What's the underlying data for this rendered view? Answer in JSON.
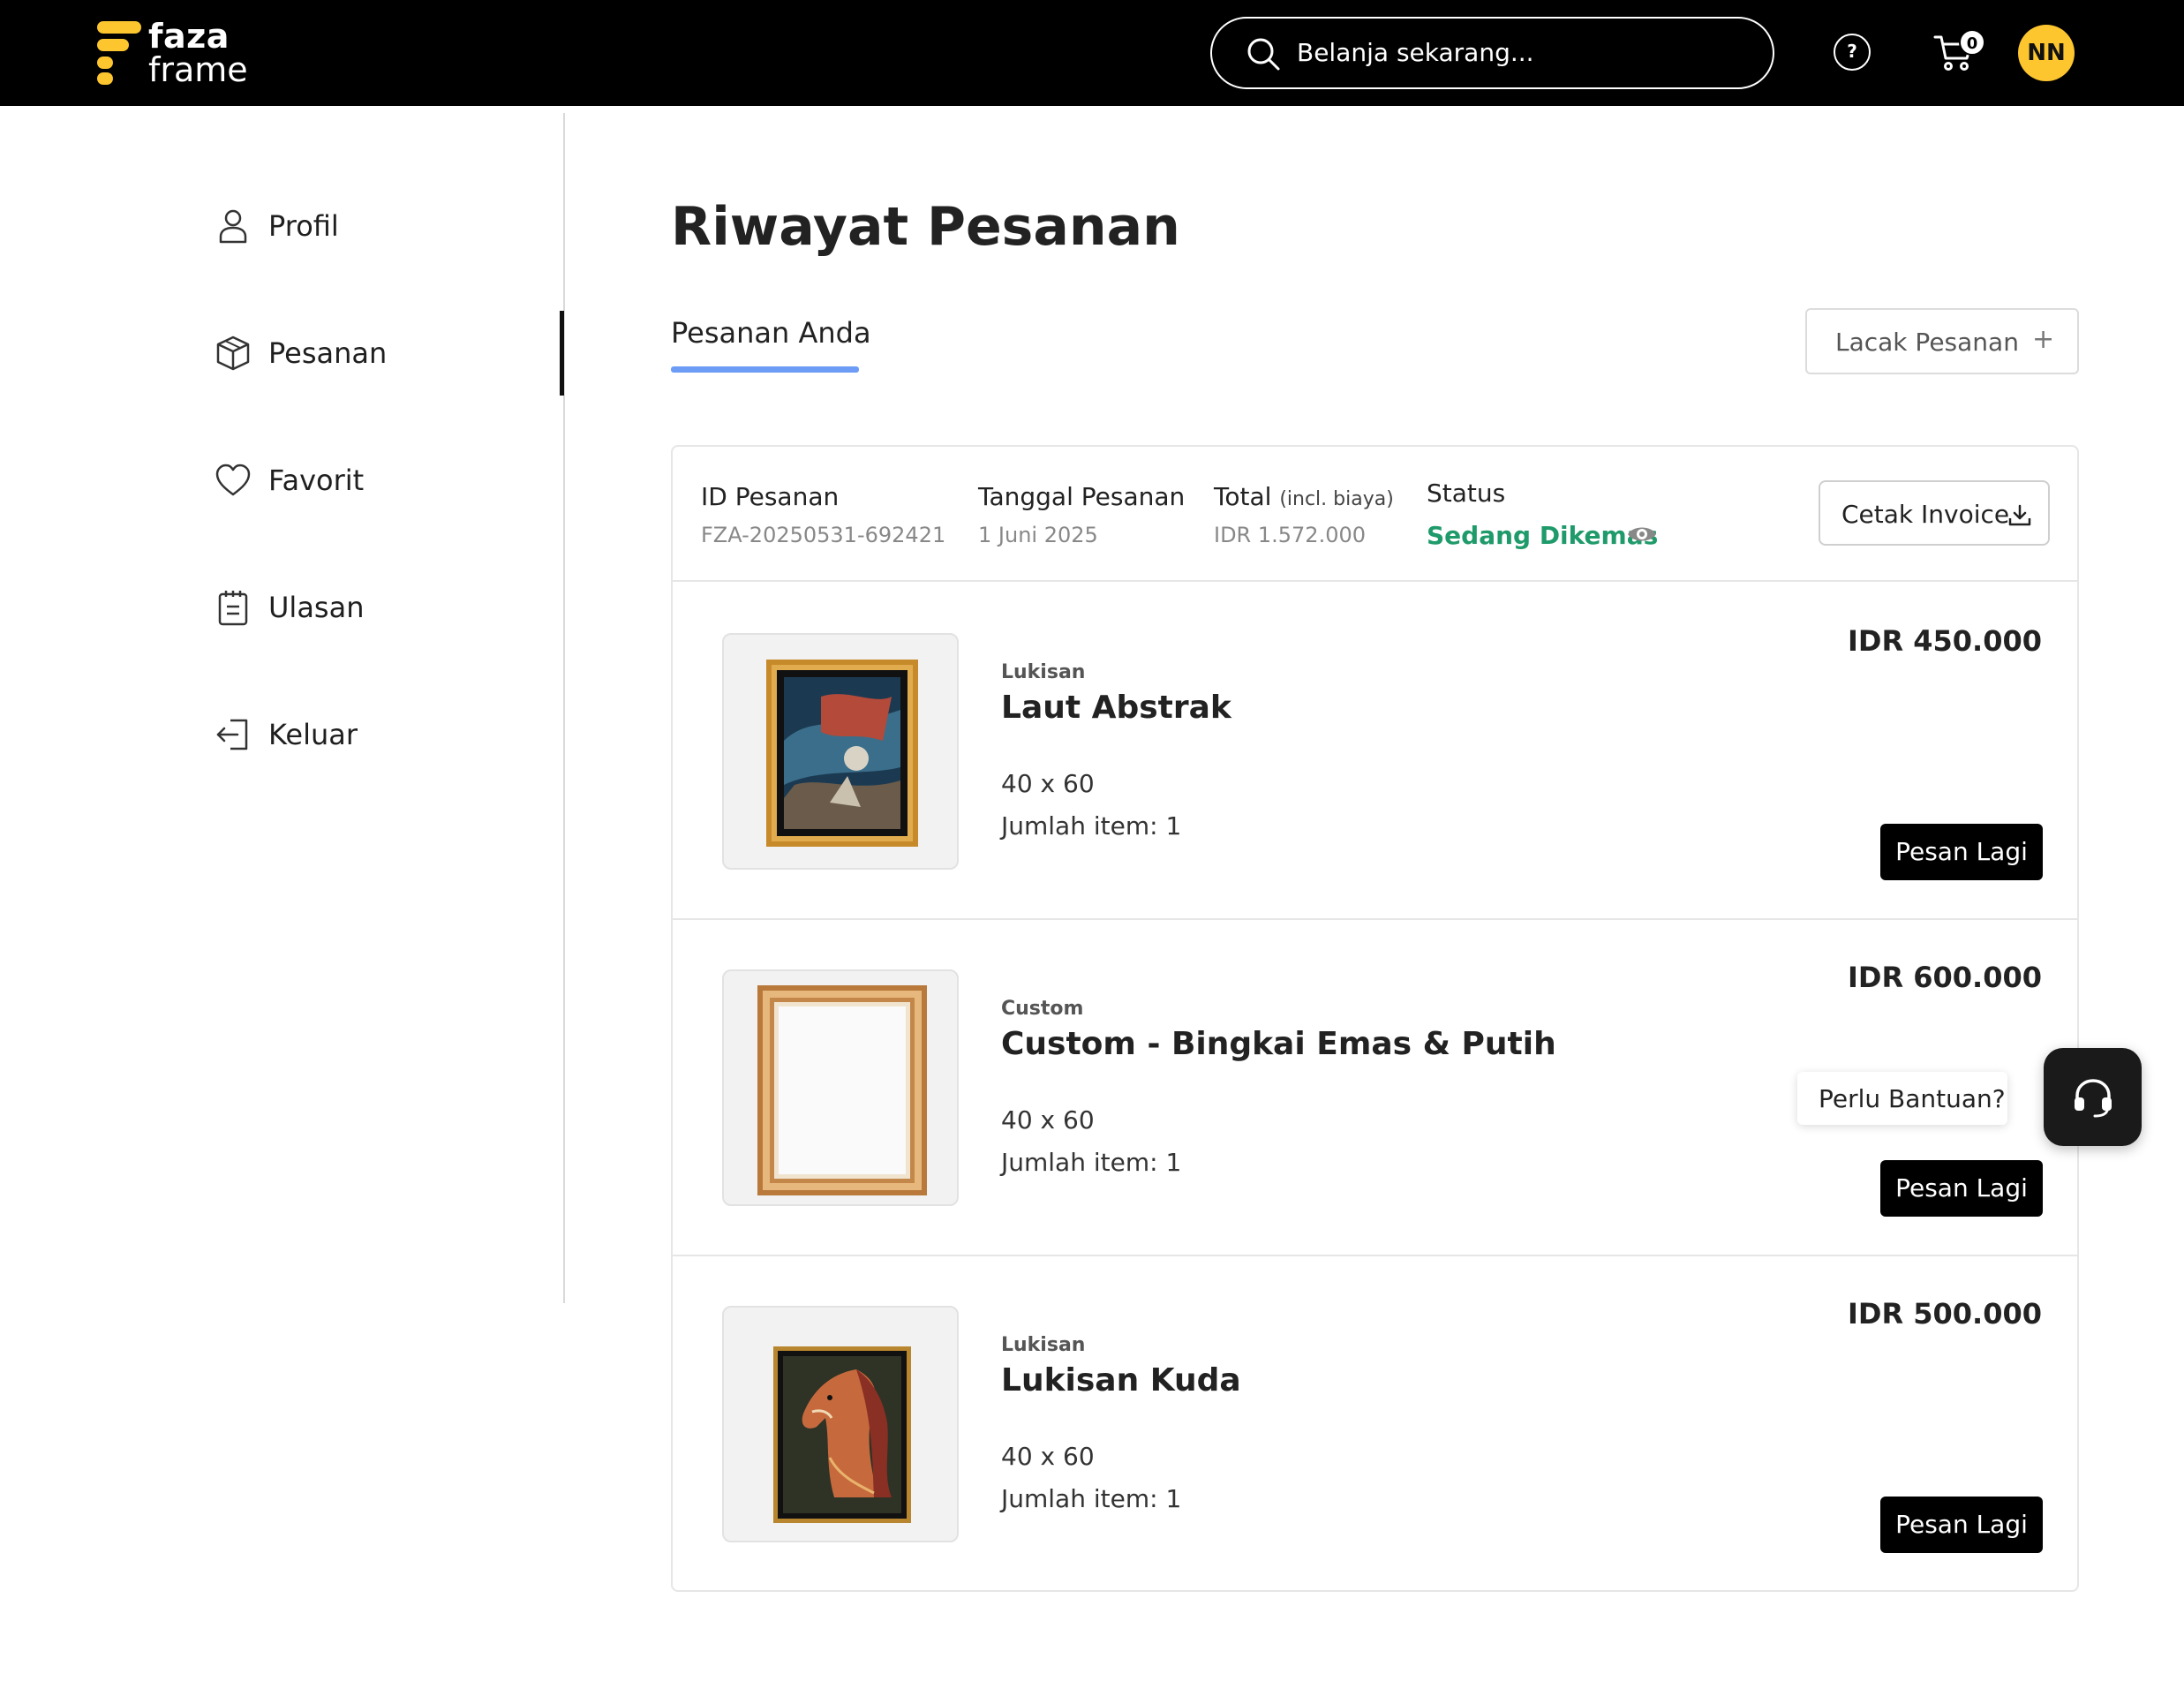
{
  "header": {
    "logo_line1": "faza",
    "logo_line2": "frame",
    "search_placeholder": "Belanja sekarang...",
    "help_label": "?",
    "cart_count": "0",
    "avatar_initials": "NN"
  },
  "sidebar": {
    "items": [
      {
        "label": "Profil",
        "icon": "user-icon"
      },
      {
        "label": "Pesanan",
        "icon": "box-icon",
        "active": true
      },
      {
        "label": "Favorit",
        "icon": "heart-icon"
      },
      {
        "label": "Ulasan",
        "icon": "clipboard-icon"
      },
      {
        "label": "Keluar",
        "icon": "logout-icon"
      }
    ]
  },
  "main": {
    "title": "Riwayat Pesanan",
    "tab": "Pesanan Anda",
    "track_button": "Lacak Pesanan",
    "track_button_icon": "+",
    "order": {
      "id_label": "ID Pesanan",
      "id_value": "FZA-20250531-692421",
      "date_label": "Tanggal Pesanan",
      "date_value": "1 Juni 2025",
      "total_label": "Total",
      "total_note": "(incl. biaya)",
      "total_value": "IDR 1.572.000",
      "status_label": "Status",
      "status_value": "Sedang Dikemas",
      "status_color": "#1f9a6a",
      "invoice_button": "Cetak Invoice",
      "items": [
        {
          "category": "Lukisan",
          "name": "Laut Abstrak",
          "size": "40 x 60",
          "qty": "Jumlah item: 1",
          "price": "IDR 450.000",
          "button": "Pesan Lagi"
        },
        {
          "category": "Custom",
          "name": "Custom - Bingkai Emas & Putih",
          "size": "40 x 60",
          "qty": "Jumlah item: 1",
          "price": "IDR 600.000",
          "button": "Pesan Lagi"
        },
        {
          "category": "Lukisan",
          "name": "Lukisan Kuda",
          "size": "40 x 60",
          "qty": "Jumlah item: 1",
          "price": "IDR 500.000",
          "button": "Pesan Lagi"
        }
      ]
    }
  },
  "help": {
    "tooltip": "Perlu Bantuan?"
  },
  "colors": {
    "brand_yellow": "#fdc62f",
    "tab_accent": "#6c9cf5",
    "topbar": "#000000"
  }
}
